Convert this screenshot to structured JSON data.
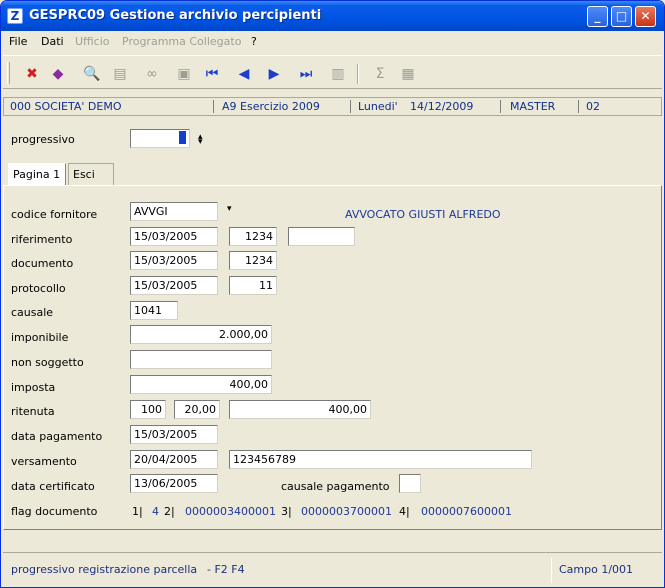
{
  "window": {
    "title": "GESPRC09  Gestione archivio percipienti",
    "app_icon_letter": "Z"
  },
  "title_buttons": {
    "minimize": "_",
    "maximize": "□",
    "close": "✕"
  },
  "menu": {
    "items": [
      {
        "label": "File",
        "enabled": true
      },
      {
        "label": "Dati",
        "enabled": true
      },
      {
        "label": "Ufficio",
        "enabled": false
      },
      {
        "label": "Programma Collegato",
        "enabled": false
      },
      {
        "label": "?",
        "enabled": true
      }
    ]
  },
  "toolbar": {
    "icons": [
      "exit-icon",
      "archive-icon",
      "search-icon",
      "print-icon",
      "binoculars-icon",
      "delete-icon",
      "first-record-icon",
      "previous-record-icon",
      "next-record-icon",
      "last-record-icon",
      "document-icon",
      "sum-icon",
      "calculator-icon"
    ],
    "glyphs": {
      "exit": "✖",
      "archive": "◆",
      "search": "🔍",
      "print": "▤",
      "binoculars": "∞",
      "delete": "▣",
      "first": "⏮",
      "prev": "◀",
      "next": "▶",
      "last": "⏭",
      "document": "▥",
      "sum": "Σ",
      "calculator": "▦"
    }
  },
  "info_bar": {
    "company": "000 SOCIETA' DEMO",
    "exercise": "A9 Esercizio 2009",
    "day": "Lunedi'",
    "date": "14/12/2009",
    "user": "MASTER",
    "terminal": "02"
  },
  "progressivo": {
    "label": "progressivo",
    "value": ""
  },
  "tabs": [
    {
      "label": "Pagina 1",
      "active": true
    },
    {
      "label": "Esci",
      "active": false
    }
  ],
  "form": {
    "codice_fornitore": {
      "label": "codice fornitore",
      "value": "AVVGI",
      "description": "AVVOCATO GIUSTI ALFREDO"
    },
    "riferimento": {
      "label": "riferimento",
      "date": "15/03/2005",
      "number": "1234",
      "extra": ""
    },
    "documento": {
      "label": "documento",
      "date": "15/03/2005",
      "number": "1234"
    },
    "protocollo": {
      "label": "protocollo",
      "date": "15/03/2005",
      "number": "11"
    },
    "causale": {
      "label": "causale",
      "value": "1041"
    },
    "imponibile": {
      "label": "imponibile",
      "value": "2.000,00"
    },
    "non_soggetto": {
      "label": "non soggetto",
      "value": ""
    },
    "imposta": {
      "label": "imposta",
      "value": "400,00"
    },
    "ritenuta": {
      "label": "ritenuta",
      "perc1": "100",
      "perc2": "20,00",
      "amount": "400,00"
    },
    "data_pagamento": {
      "label": "data pagamento",
      "value": "15/03/2005"
    },
    "versamento": {
      "label": "versamento",
      "date": "20/04/2005",
      "code": "123456789"
    },
    "data_certificato": {
      "label": "data certificato",
      "value": "13/06/2005"
    },
    "causale_pagamento": {
      "label": "causale pagamento",
      "value": ""
    },
    "flag_documento": {
      "label": "flag documento",
      "f1": "1|",
      "f1_value": "4",
      "f2": "2|",
      "f2_value": "0000003400001",
      "f3": "3|",
      "f3_value": "0000003700001",
      "f4": "4|",
      "f4_value": "0000007600001"
    }
  },
  "statusbar": {
    "message": "progressivo registrazione parcella",
    "keys": "- F2  F4",
    "field_counter": "Campo  1/001"
  }
}
